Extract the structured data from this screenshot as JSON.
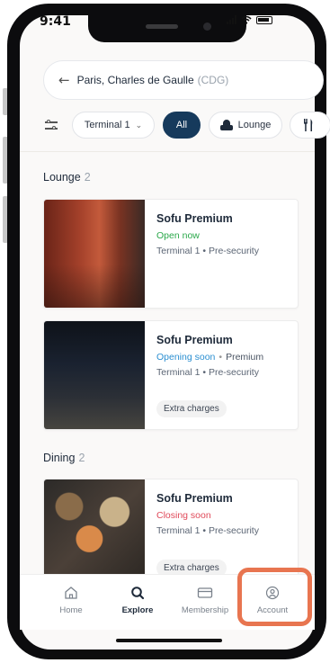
{
  "status_bar": {
    "time": "9:41"
  },
  "search": {
    "location": "Paris, Charles de Gaulle",
    "code": "(CDG)"
  },
  "filters": {
    "terminal": "Terminal 1",
    "all": "All",
    "lounge": "Lounge"
  },
  "sections": [
    {
      "title": "Lounge",
      "count": "2",
      "cards": [
        {
          "name": "Sofu Premium",
          "status": "Open now",
          "status_color": "#2aa84a",
          "tier": "",
          "location": "Terminal 1 • Pre-security",
          "tag": ""
        },
        {
          "name": "Sofu Premium",
          "status": "Opening soon",
          "status_color": "#2b8fd1",
          "tier": "Premium",
          "location": "Terminal 1 • Pre-security",
          "tag": "Extra charges"
        }
      ]
    },
    {
      "title": "Dining",
      "count": "2",
      "cards": [
        {
          "name": "Sofu Premium",
          "status": "Closing soon",
          "status_color": "#e04a5a",
          "tier": "",
          "location": "Terminal 1 • Pre-security",
          "tag": "Extra charges"
        }
      ]
    }
  ],
  "tabbar": {
    "home": "Home",
    "explore": "Explore",
    "membership": "Membership",
    "account": "Account"
  },
  "colors": {
    "accent": "#163a5c",
    "highlight": "#e87550"
  },
  "icons": [
    "back-arrow-icon",
    "filter-sliders-icon",
    "chevron-down-icon",
    "lounge-armchair-icon",
    "dining-cutlery-icon",
    "home-icon",
    "search-icon",
    "card-icon",
    "user-icon"
  ]
}
